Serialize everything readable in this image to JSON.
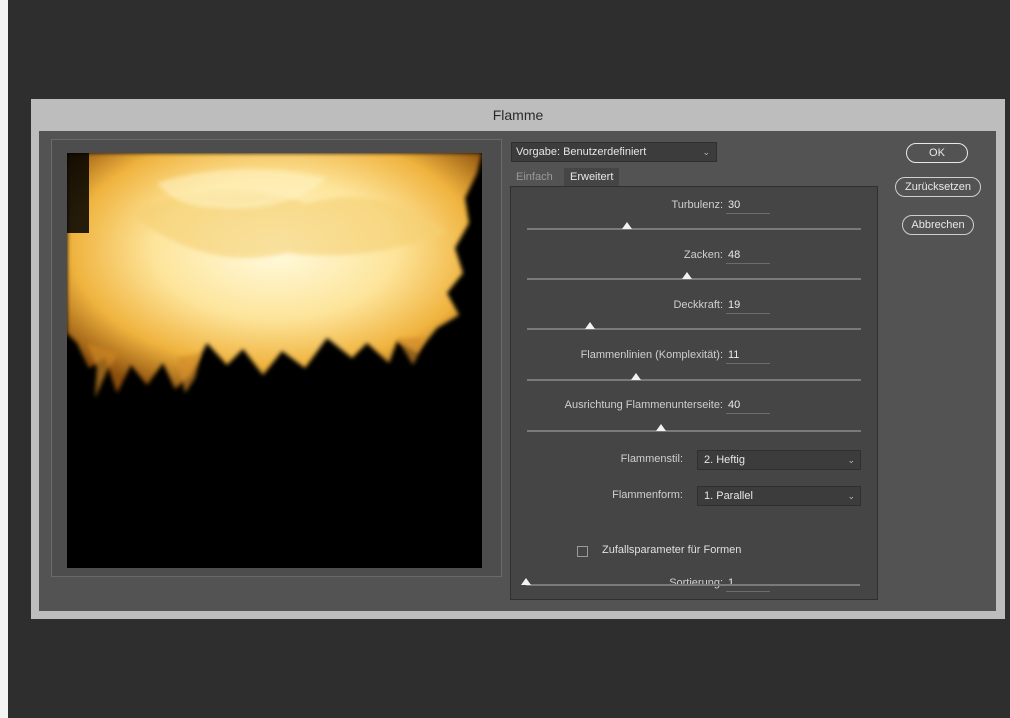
{
  "dialog": {
    "title": "Flamme"
  },
  "preset": {
    "label": "Vorgabe:",
    "value": "Benutzerdefiniert",
    "text": "Vorgabe: Benutzerdefiniert"
  },
  "tabs": [
    {
      "label": "Einfach",
      "active": false
    },
    {
      "label": "Erweitert",
      "active": true
    }
  ],
  "sliders": [
    {
      "label": "Turbulenz:",
      "value": "30",
      "fraction": 0.3
    },
    {
      "label": "Zacken:",
      "value": "48",
      "fraction": 0.48
    },
    {
      "label": "Deckkraft:",
      "value": "19",
      "fraction": 0.19
    },
    {
      "label": "Flammenlinien (Komplexität):",
      "value": "11",
      "fraction": 0.325
    },
    {
      "label": "Ausrichtung Flammenunterseite:",
      "value": "40",
      "fraction": 0.4
    }
  ],
  "flame_style": {
    "label": "Flammenstil:",
    "value": "2. Heftig"
  },
  "flame_shape": {
    "label": "Flammenform:",
    "value": "1. Parallel"
  },
  "random_shapes": {
    "label": "Zufallsparameter für Formen",
    "checked": false
  },
  "sorting": {
    "label": "Sortierung:",
    "value": "1",
    "fraction": 0.0
  },
  "buttons": {
    "ok": "OK",
    "reset": "Zurücksetzen",
    "cancel": "Abbrechen"
  },
  "colors": {
    "flame_core": "#fff6c8",
    "flame_mid": "#f6c24a",
    "flame_edge": "#b06a12",
    "background": "#000000"
  }
}
